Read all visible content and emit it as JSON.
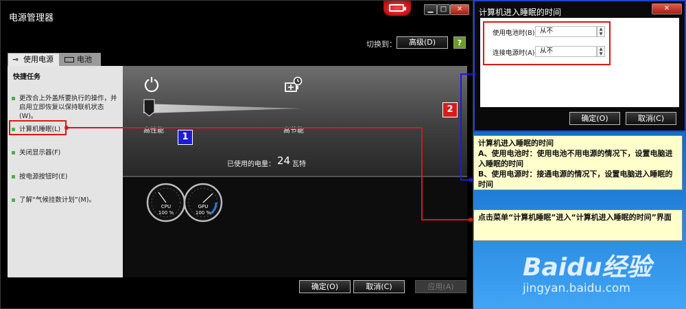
{
  "main_window": {
    "title": "电源管理器",
    "switch_label": "切换到：",
    "advanced_button": "高级(D)",
    "tabs": [
      "使用电源",
      "电池"
    ],
    "sidebar": {
      "title": "快捷任务",
      "items": [
        "更改合上外盖所要执行的操作，并启用立即恢复以保持联机状态(W)。",
        "计算机睡眠(L)",
        "关闭显示器(F)",
        "按电源按钮时(E)",
        "了解“气候挂数计划”(M)。"
      ]
    },
    "panel": {
      "performance_label": "高性能",
      "saving_label": "高节能",
      "used_power_label": "已使用的电量：",
      "used_power_value": "24",
      "used_power_unit": "瓦特",
      "cpu_label": "CPU",
      "cpu_value": "100 %",
      "gpu_label": "GPU",
      "gpu_value": "100 %"
    },
    "buttons": {
      "ok": "确定(O)",
      "cancel": "取消(C)",
      "apply": "应用(A)"
    },
    "window_controls": [
      "▁",
      "□",
      "✕"
    ]
  },
  "sleep_dialog": {
    "title": "计算机进入睡眠的时间",
    "close": "✕",
    "battery_label": "使用电池时(B)：",
    "battery_value": "从不",
    "plugged_label": "连接电源时(A)：",
    "plugged_value": "从不",
    "spin_up": "▲",
    "spin_down": "▼",
    "ok": "确定(O)",
    "cancel": "取消(C)"
  },
  "annotations": {
    "badge_1": "1",
    "badge_2": "2",
    "note_1": [
      "计算机进入睡眠的时间",
      "A、使用电池时：使用电池不用电源的情况下，设置电脑进入睡眠的时间",
      "B、使用电源时：接通电源的情况下，设置电脑进入睡眠的时间"
    ],
    "note_2": "点击菜单“计算机睡眠”进入“计算机进入睡眠的时间”界面"
  },
  "watermark": {
    "logo": "Baidu经验",
    "url": "jingyan.baidu.com"
  },
  "colors": {
    "highlight": "#d81818",
    "badge_blue": "#1c1cd6",
    "badge_red": "#d61c1c",
    "note_bg": "#ffffcc"
  }
}
